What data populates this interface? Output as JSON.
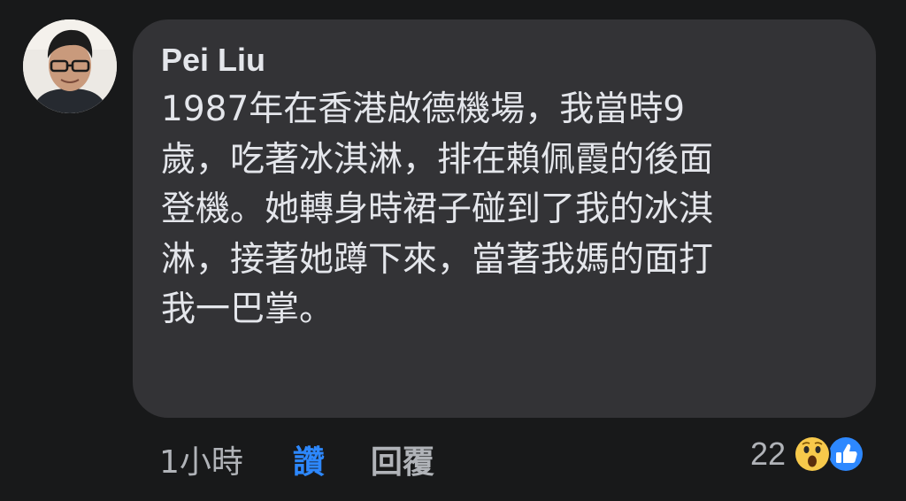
{
  "comment": {
    "author": "Pei Liu",
    "text_lines": [
      "1987年在香港啟德機場，我當時9",
      "歲，吃著冰淇淋，排在賴佩霞的後面",
      "登機。她轉身時裙子碰到了我的冰淇",
      "淋，接著她蹲下來，當著我媽的面打",
      "我一巴掌。"
    ]
  },
  "actions": {
    "time": "1小時",
    "like_label": "讚",
    "reply_label": "回覆"
  },
  "reactions": {
    "count": "22",
    "icons": [
      "wow-reaction-icon",
      "like-reaction-icon"
    ]
  },
  "colors": {
    "background": "#18191a",
    "bubble": "#333336",
    "text": "#e4e6eb",
    "secondary_text": "#b0b3b8",
    "like_blue": "#2d88ff",
    "wow_yellow": "#f7c94b"
  }
}
